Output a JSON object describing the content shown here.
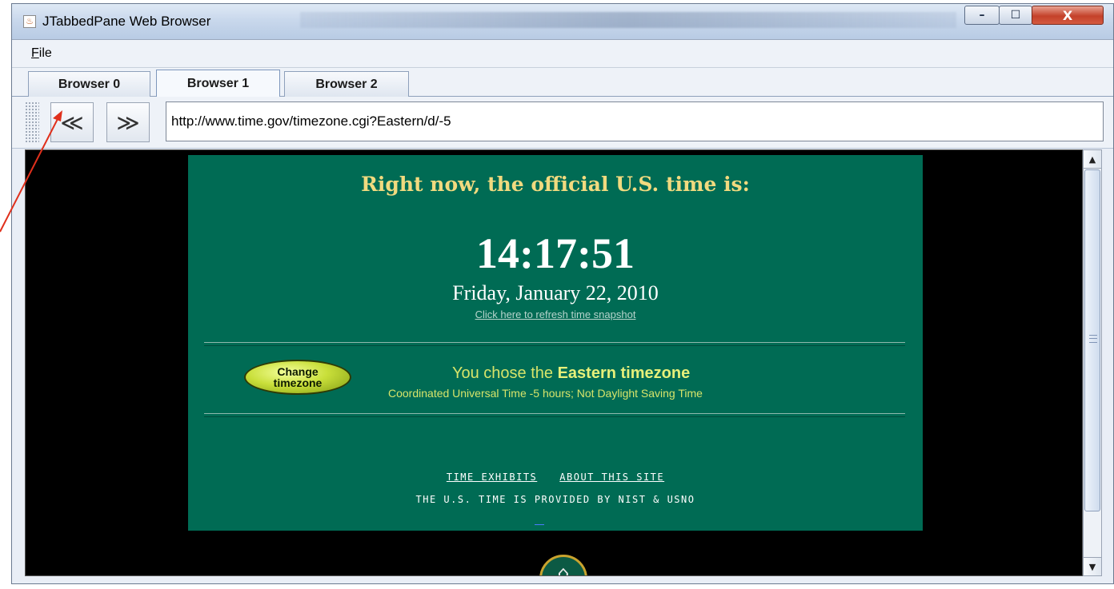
{
  "window": {
    "title": "JTabbedPane Web Browser",
    "icon": "java-icon",
    "controls": {
      "minimize": "–",
      "maximize": "☐",
      "close": "X"
    }
  },
  "menu": {
    "file_label": "File",
    "file_mnemonic": "F",
    "file_rest": "ile"
  },
  "tabs": [
    {
      "label": "Browser 0",
      "selected": false
    },
    {
      "label": "Browser 1",
      "selected": true
    },
    {
      "label": "Browser 2",
      "selected": false
    }
  ],
  "toolbar": {
    "back_glyph": "≪",
    "forward_glyph": "≫",
    "url": "http://www.time.gov/timezone.cgi?Eastern/d/-5"
  },
  "page": {
    "headline": "Right now, the official U.S. time is:",
    "time": "14:17:51",
    "date": "Friday, January 22, 2010",
    "refresh_link": "Click here to refresh time snapshot",
    "change_button_line1": "Change",
    "change_button_line2": "timezone",
    "tz_prefix": "You chose the ",
    "tz_name": "Eastern timezone",
    "tz_detail": "Coordinated Universal Time -5 hours; Not Daylight Saving Time",
    "link_exhibits": "TIME EXHIBITS",
    "link_about": "ABOUT THIS SITE",
    "provided_by": "THE U.S. TIME IS PROVIDED BY NIST & USNO"
  },
  "colors": {
    "panel": "#006b54",
    "headline": "#f1da7f",
    "annotation_arrow": "#e0301c"
  }
}
